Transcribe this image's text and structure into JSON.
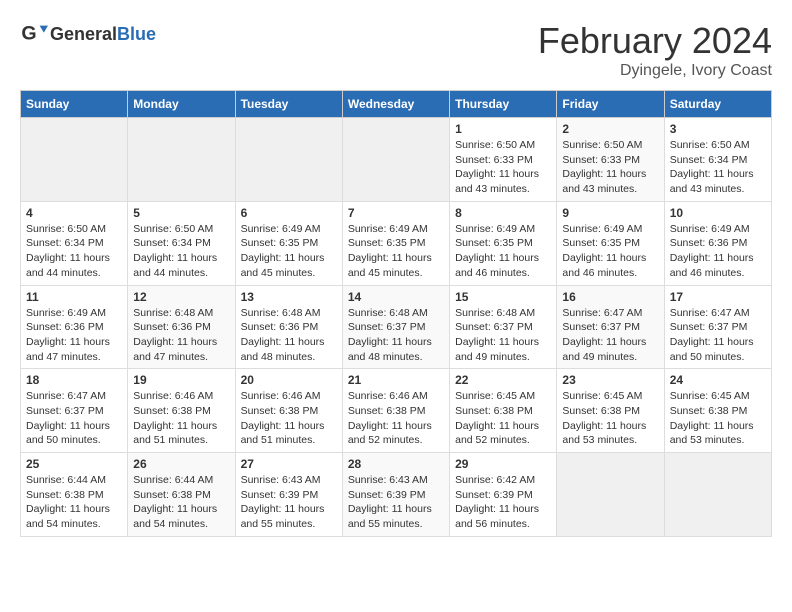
{
  "header": {
    "logo_general": "General",
    "logo_blue": "Blue",
    "main_title": "February 2024",
    "subtitle": "Dyingele, Ivory Coast"
  },
  "weekdays": [
    "Sunday",
    "Monday",
    "Tuesday",
    "Wednesday",
    "Thursday",
    "Friday",
    "Saturday"
  ],
  "weeks": [
    [
      {
        "day": "",
        "detail": ""
      },
      {
        "day": "",
        "detail": ""
      },
      {
        "day": "",
        "detail": ""
      },
      {
        "day": "",
        "detail": ""
      },
      {
        "day": "1",
        "detail": "Sunrise: 6:50 AM\nSunset: 6:33 PM\nDaylight: 11 hours and 43 minutes."
      },
      {
        "day": "2",
        "detail": "Sunrise: 6:50 AM\nSunset: 6:33 PM\nDaylight: 11 hours and 43 minutes."
      },
      {
        "day": "3",
        "detail": "Sunrise: 6:50 AM\nSunset: 6:34 PM\nDaylight: 11 hours and 43 minutes."
      }
    ],
    [
      {
        "day": "4",
        "detail": "Sunrise: 6:50 AM\nSunset: 6:34 PM\nDaylight: 11 hours and 44 minutes."
      },
      {
        "day": "5",
        "detail": "Sunrise: 6:50 AM\nSunset: 6:34 PM\nDaylight: 11 hours and 44 minutes."
      },
      {
        "day": "6",
        "detail": "Sunrise: 6:49 AM\nSunset: 6:35 PM\nDaylight: 11 hours and 45 minutes."
      },
      {
        "day": "7",
        "detail": "Sunrise: 6:49 AM\nSunset: 6:35 PM\nDaylight: 11 hours and 45 minutes."
      },
      {
        "day": "8",
        "detail": "Sunrise: 6:49 AM\nSunset: 6:35 PM\nDaylight: 11 hours and 46 minutes."
      },
      {
        "day": "9",
        "detail": "Sunrise: 6:49 AM\nSunset: 6:35 PM\nDaylight: 11 hours and 46 minutes."
      },
      {
        "day": "10",
        "detail": "Sunrise: 6:49 AM\nSunset: 6:36 PM\nDaylight: 11 hours and 46 minutes."
      }
    ],
    [
      {
        "day": "11",
        "detail": "Sunrise: 6:49 AM\nSunset: 6:36 PM\nDaylight: 11 hours and 47 minutes."
      },
      {
        "day": "12",
        "detail": "Sunrise: 6:48 AM\nSunset: 6:36 PM\nDaylight: 11 hours and 47 minutes."
      },
      {
        "day": "13",
        "detail": "Sunrise: 6:48 AM\nSunset: 6:36 PM\nDaylight: 11 hours and 48 minutes."
      },
      {
        "day": "14",
        "detail": "Sunrise: 6:48 AM\nSunset: 6:37 PM\nDaylight: 11 hours and 48 minutes."
      },
      {
        "day": "15",
        "detail": "Sunrise: 6:48 AM\nSunset: 6:37 PM\nDaylight: 11 hours and 49 minutes."
      },
      {
        "day": "16",
        "detail": "Sunrise: 6:47 AM\nSunset: 6:37 PM\nDaylight: 11 hours and 49 minutes."
      },
      {
        "day": "17",
        "detail": "Sunrise: 6:47 AM\nSunset: 6:37 PM\nDaylight: 11 hours and 50 minutes."
      }
    ],
    [
      {
        "day": "18",
        "detail": "Sunrise: 6:47 AM\nSunset: 6:37 PM\nDaylight: 11 hours and 50 minutes."
      },
      {
        "day": "19",
        "detail": "Sunrise: 6:46 AM\nSunset: 6:38 PM\nDaylight: 11 hours and 51 minutes."
      },
      {
        "day": "20",
        "detail": "Sunrise: 6:46 AM\nSunset: 6:38 PM\nDaylight: 11 hours and 51 minutes."
      },
      {
        "day": "21",
        "detail": "Sunrise: 6:46 AM\nSunset: 6:38 PM\nDaylight: 11 hours and 52 minutes."
      },
      {
        "day": "22",
        "detail": "Sunrise: 6:45 AM\nSunset: 6:38 PM\nDaylight: 11 hours and 52 minutes."
      },
      {
        "day": "23",
        "detail": "Sunrise: 6:45 AM\nSunset: 6:38 PM\nDaylight: 11 hours and 53 minutes."
      },
      {
        "day": "24",
        "detail": "Sunrise: 6:45 AM\nSunset: 6:38 PM\nDaylight: 11 hours and 53 minutes."
      }
    ],
    [
      {
        "day": "25",
        "detail": "Sunrise: 6:44 AM\nSunset: 6:38 PM\nDaylight: 11 hours and 54 minutes."
      },
      {
        "day": "26",
        "detail": "Sunrise: 6:44 AM\nSunset: 6:38 PM\nDaylight: 11 hours and 54 minutes."
      },
      {
        "day": "27",
        "detail": "Sunrise: 6:43 AM\nSunset: 6:39 PM\nDaylight: 11 hours and 55 minutes."
      },
      {
        "day": "28",
        "detail": "Sunrise: 6:43 AM\nSunset: 6:39 PM\nDaylight: 11 hours and 55 minutes."
      },
      {
        "day": "29",
        "detail": "Sunrise: 6:42 AM\nSunset: 6:39 PM\nDaylight: 11 hours and 56 minutes."
      },
      {
        "day": "",
        "detail": ""
      },
      {
        "day": "",
        "detail": ""
      }
    ]
  ]
}
